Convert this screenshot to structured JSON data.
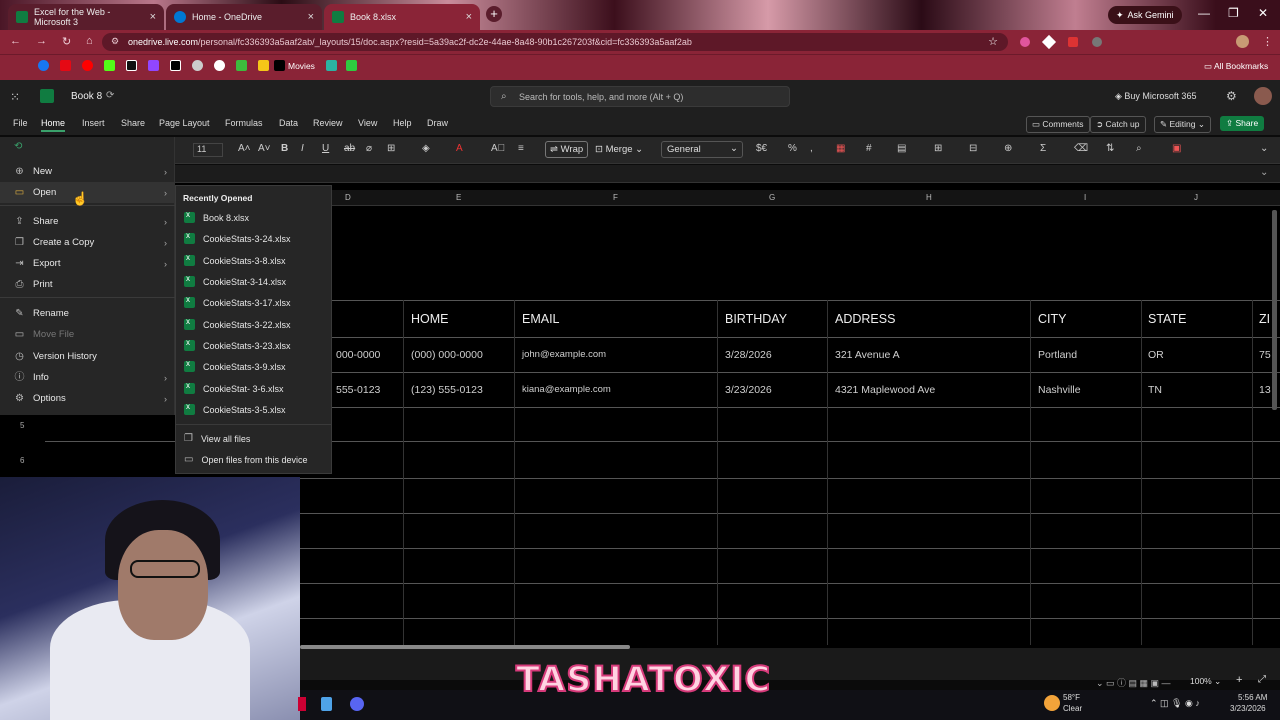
{
  "browser": {
    "tabs": [
      {
        "label": "Excel for the Web - Microsoft 3",
        "color": "#107c41"
      },
      {
        "label": "Home - OneDrive",
        "color": "#0078d4"
      },
      {
        "label": "Book 8.xlsx",
        "color": "#107c41"
      }
    ],
    "ask_gemini": "Ask Gemini",
    "url_host": "onedrive.live.com",
    "url_path": "/personal/fc336393a5aaf2ab/_layouts/15/doc.aspx?resid=5a39ac2f-dc2e-44ae-8a48-90b1c267203f&cid=fc336393a5aaf2ab",
    "bookmark_movies": "Movies",
    "all_bookmarks": "All Bookmarks"
  },
  "app": {
    "doc_title": "Book 8",
    "search_placeholder": "Search for tools, help, and more (Alt + Q)",
    "buy": "Buy Microsoft 365",
    "menus": [
      "File",
      "Home",
      "Insert",
      "Share",
      "Page Layout",
      "Formulas",
      "Data",
      "Review",
      "View",
      "Help",
      "Draw"
    ],
    "comments": "Comments",
    "catch_up": "Catch up",
    "editing": "Editing",
    "share": "Share"
  },
  "ribbon": {
    "font_size": "11",
    "wrap": "Wrap",
    "merge": "Merge",
    "number_format": "General"
  },
  "file_menu": {
    "items": [
      {
        "label": "New",
        "icon": "plus-icon",
        "submenu": true
      },
      {
        "label": "Open",
        "icon": "folder-icon",
        "submenu": true
      },
      {
        "label": "Share",
        "icon": "share-icon",
        "submenu": true
      },
      {
        "label": "Create a Copy",
        "icon": "copy-icon",
        "submenu": true
      },
      {
        "label": "Export",
        "icon": "export-icon",
        "submenu": true
      },
      {
        "label": "Print",
        "icon": "printer-icon",
        "submenu": false
      },
      {
        "label": "Rename",
        "icon": "rename-icon",
        "submenu": false
      },
      {
        "label": "Move File",
        "icon": "move-icon",
        "submenu": false,
        "disabled": true
      },
      {
        "label": "Version History",
        "icon": "history-icon",
        "submenu": false
      },
      {
        "label": "Info",
        "icon": "info-icon",
        "submenu": true
      },
      {
        "label": "Options",
        "icon": "gear-icon",
        "submenu": true
      }
    ]
  },
  "open_submenu": {
    "heading": "Recently Opened",
    "files": [
      "Book 8.xlsx",
      "CookieStats-3-24.xlsx",
      "CookieStats-3-8.xlsx",
      "CookieStat-3-14.xlsx",
      "CookieStats-3-17.xlsx",
      "CookieStats-3-22.xlsx",
      "CookieStats-3-23.xlsx",
      "CookieStats-3-9.xlsx",
      "CookieStat- 3-6.xlsx",
      "CookieStats-3-5.xlsx"
    ],
    "view_all": "View all files",
    "open_device": "Open files from this device"
  },
  "sheet": {
    "columns": [
      "D",
      "E",
      "F",
      "G",
      "H",
      "I",
      "J"
    ],
    "row_numbers": [
      "5",
      "6"
    ],
    "headers": [
      "HOME",
      "EMAIL",
      "BIRTHDAY",
      "ADDRESS",
      "CITY",
      "STATE",
      "ZI"
    ],
    "rows": [
      [
        "000-0000",
        "(000) 000-0000",
        "john@example.com",
        "3/28/2026",
        "321 Avenue A",
        "Portland",
        "OR",
        "75"
      ],
      [
        "555-0123",
        "(123) 555-0123",
        "kiana@example.com",
        "3/23/2026",
        "4321 Maplewood Ave",
        "Nashville",
        "TN",
        "13"
      ]
    ]
  },
  "status": {
    "zoom": "100%"
  },
  "overlay": {
    "brand": "TASHATOXIC"
  },
  "taskbar": {
    "temp": "58°F",
    "weather": "Clear",
    "time": "5:56 AM",
    "date": "3/23/2026"
  }
}
